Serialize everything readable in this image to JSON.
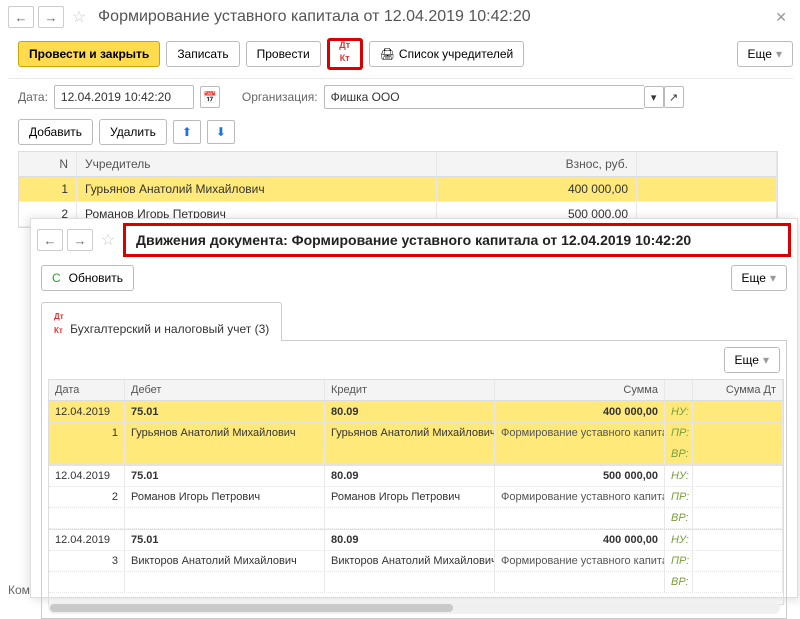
{
  "win1": {
    "title": "Формирование уставного капитала от 12.04.2019 10:42:20",
    "toolbar": {
      "post_close": "Провести и закрыть",
      "record": "Записать",
      "post": "Провести",
      "founders": "Список учредителей",
      "more": "Еще"
    },
    "form": {
      "date_label": "Дата:",
      "date_value": "12.04.2019 10:42:20",
      "org_label": "Организация:",
      "org_value": "Фишка ООО"
    },
    "toolbar2": {
      "add": "Добавить",
      "del": "Удалить"
    },
    "grid": {
      "headers": {
        "n": "N",
        "founder": "Учредитель",
        "amount": "Взнос, руб."
      },
      "rows": [
        {
          "n": "1",
          "founder": "Гурьянов Анатолий Михайлович",
          "amount": "400 000,00"
        },
        {
          "n": "2",
          "founder": "Романов Игорь Петрович",
          "amount": "500 000,00"
        }
      ]
    },
    "comment_label": "Комм"
  },
  "win2": {
    "title": "Движения документа: Формирование уставного капитала от 12.04.2019 10:42:20",
    "refresh": "Обновить",
    "more": "Еще",
    "tab": "Бухгалтерский и налоговый учет (3)",
    "headers": {
      "date": "Дата",
      "debit": "Дебет",
      "credit": "Кредит",
      "sum": "Сумма",
      "sumdt": "Сумма Дт"
    },
    "tags": {
      "nu": "НУ:",
      "pr": "ПР:",
      "vr": "ВР:"
    },
    "rows": [
      {
        "date": "12.04.2019",
        "n": "1",
        "deb_acc": "75.01",
        "deb_sub": "Гурьянов Анатолий Михайлович",
        "kre_acc": "80.09",
        "kre_sub": "Гурьянов Анатолий Михайлович",
        "sum": "400 000,00",
        "desc": "Формирование уставного капитала"
      },
      {
        "date": "12.04.2019",
        "n": "2",
        "deb_acc": "75.01",
        "deb_sub": "Романов Игорь Петрович",
        "kre_acc": "80.09",
        "kre_sub": "Романов Игорь Петрович",
        "sum": "500 000,00",
        "desc": "Формирование уставного капитала"
      },
      {
        "date": "12.04.2019",
        "n": "3",
        "deb_acc": "75.01",
        "deb_sub": "Викторов Анатолий Михайлович",
        "kre_acc": "80.09",
        "kre_sub": "Викторов Анатолий Михайлович",
        "sum": "400 000,00",
        "desc": "Формирование уставного капитала"
      }
    ]
  }
}
